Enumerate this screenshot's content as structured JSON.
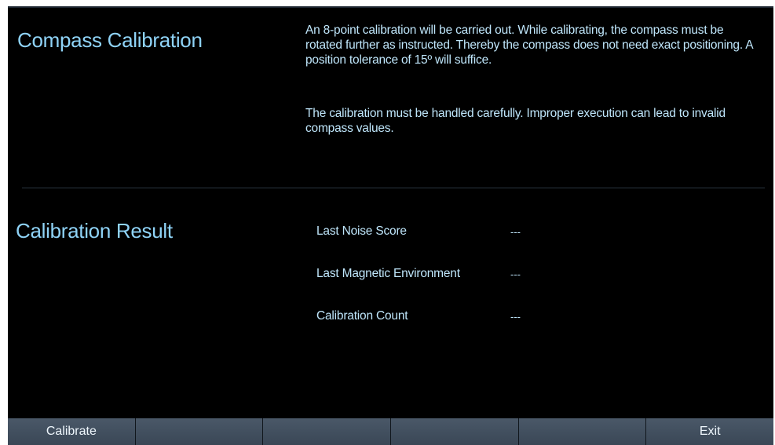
{
  "calibration": {
    "title": "Compass Calibration",
    "description_1": "An 8-point calibration will be carried out. While calibrating, the compass must be rotated further as instructed. Thereby the compass does not need exact positioning. A position tolerance of 15º will suffice.",
    "description_2": "The calibration must be handled carefully. Improper execution can lead to invalid compass values."
  },
  "result": {
    "title": "Calibration Result",
    "rows": [
      {
        "label": "Last Noise Score",
        "value": "---"
      },
      {
        "label": "Last Magnetic Environment",
        "value": "---"
      },
      {
        "label": "Calibration Count",
        "value": "---"
      }
    ]
  },
  "softkeys": [
    "Calibrate",
    "",
    "",
    "",
    "",
    "Exit"
  ],
  "colors": {
    "background": "#000000",
    "title_text": "#8fd3f7",
    "body_text": "#bfe6fb",
    "softkey_bg": "#44515f",
    "softkey_text": "#eef6fc"
  }
}
